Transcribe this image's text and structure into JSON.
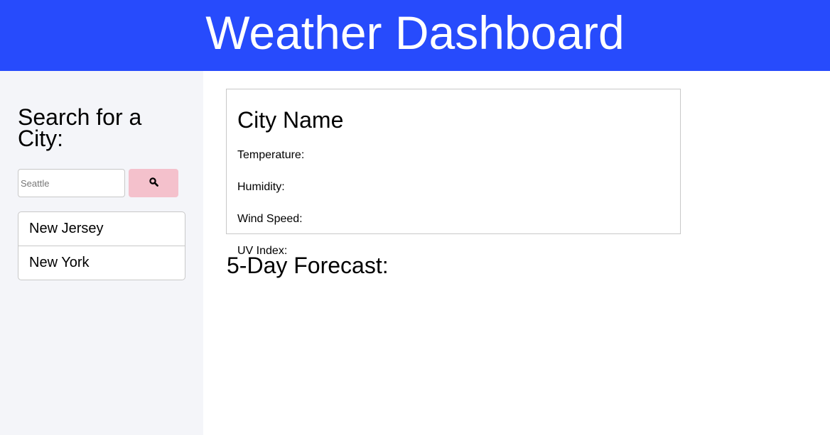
{
  "header": {
    "title": "Weather Dashboard"
  },
  "sidebar": {
    "heading": "Search for a City:",
    "search": {
      "placeholder": "Seattle",
      "value": ""
    },
    "search_button_icon": "search-icon",
    "history": [
      {
        "label": "New Jersey"
      },
      {
        "label": "New York"
      }
    ]
  },
  "current": {
    "city": "City Name",
    "temperature_label": "Temperature:",
    "humidity_label": "Humidity:",
    "wind_label": "Wind Speed:",
    "uv_label": "UV Index:"
  },
  "forecast": {
    "title": "5-Day Forecast:"
  },
  "colors": {
    "header_bg": "#274bfc",
    "sidebar_bg": "#f4f5f9",
    "search_button_bg": "#f4c1cc"
  }
}
